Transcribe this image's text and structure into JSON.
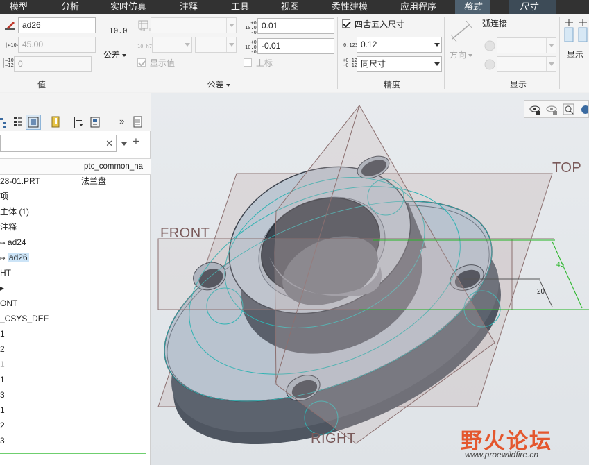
{
  "menubar": {
    "tabs": [
      "模型",
      "分析",
      "实时仿真",
      "注释",
      "工具",
      "视图",
      "柔性建模",
      "应用程序"
    ],
    "context_tabs": [
      "格式",
      "尺寸"
    ]
  },
  "ribbon": {
    "value_group": {
      "label": "值",
      "name_value": "ad26",
      "nominal_value": "45.00",
      "override_value": "0"
    },
    "tolerance_group": {
      "label": "公差",
      "display_text": "10.0",
      "tolerance_label": "公差",
      "show_value_label": "显示值",
      "upper_label": "上标",
      "upper_value": "0.01",
      "lower_value": "-0.01"
    },
    "precision_group": {
      "label": "精度",
      "round_label": "四舍五入尺寸",
      "decimals_value": "0.12",
      "tolerance_precision_value": "同尺寸"
    },
    "display_group": {
      "label": "显示",
      "direction_label": "方向",
      "arc_label": "弧连接"
    },
    "extra_group": {
      "label": "显示"
    }
  },
  "tree": {
    "filter_placeholder": "",
    "column_header": "ptc_common_na",
    "rows": [
      {
        "label": "28-01.PRT",
        "value": "法兰盘"
      },
      {
        "label": "项",
        "value": ""
      },
      {
        "label": "主体 (1)",
        "value": ""
      },
      {
        "label": "注释",
        "value": ""
      },
      {
        "label": "ad24",
        "value": ""
      },
      {
        "label": "ad26",
        "value": ""
      },
      {
        "label": "HT",
        "value": ""
      },
      {
        "label": "",
        "value": ""
      },
      {
        "label": "ONT",
        "value": ""
      },
      {
        "label": "_CSYS_DEF",
        "value": ""
      },
      {
        "label": "1",
        "value": ""
      },
      {
        "label": "2",
        "value": ""
      },
      {
        "label": "1",
        "value": ""
      },
      {
        "label": "1",
        "value": ""
      },
      {
        "label": "3",
        "value": ""
      },
      {
        "label": "1",
        "value": ""
      },
      {
        "label": "2",
        "value": ""
      },
      {
        "label": "3",
        "value": ""
      }
    ]
  },
  "viewport": {
    "datums": {
      "top": "TOP",
      "front": "FRONT",
      "right": "RIGHT"
    },
    "dim_45": "45",
    "dim_20": "20"
  },
  "watermark": {
    "logo_text": "野火论坛",
    "url": "www.proewildfire.cn"
  },
  "colors": {
    "menubar": "#323232",
    "context_tab": "#4f6170",
    "model_face": "#b8c3cf",
    "datum_plane": "#c9b5b5",
    "sketch_cyan": "#2fb3b3",
    "dim_green": "#22b422",
    "selection": "#cce4f7"
  }
}
